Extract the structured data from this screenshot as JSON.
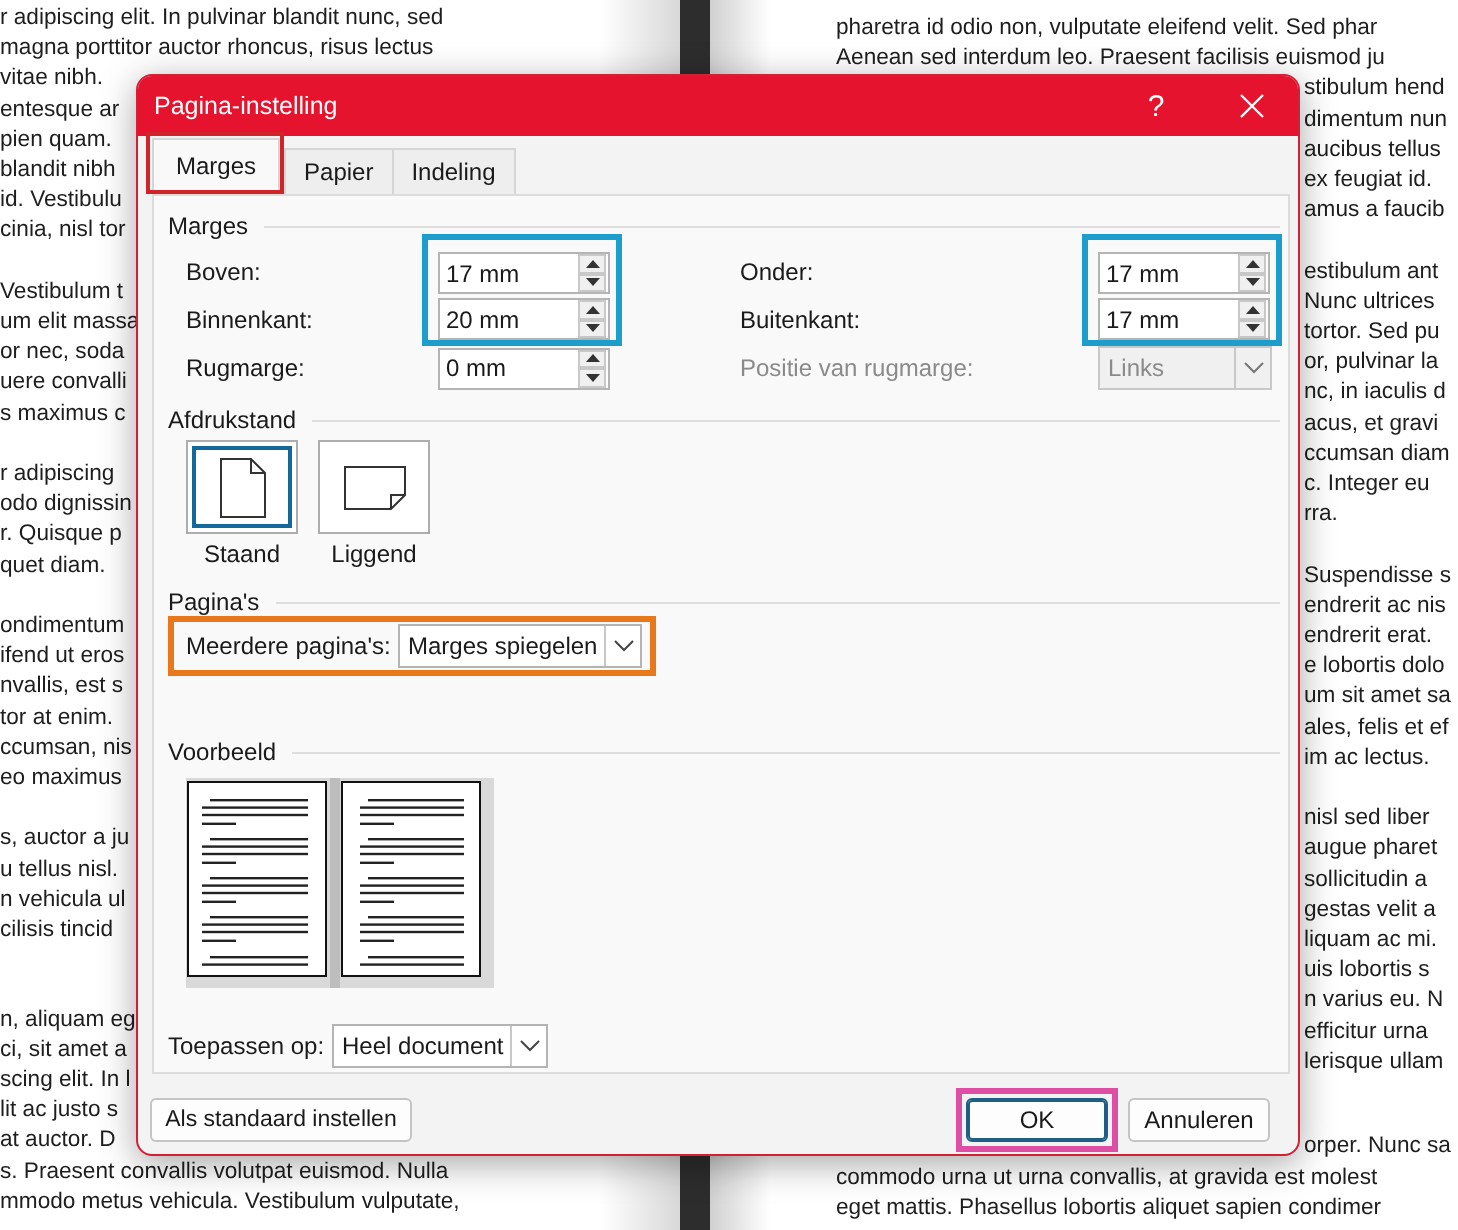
{
  "left_page": {
    "paragraphs": [
      [
        "r adipiscing elit. In pulvinar blandit nunc, sed",
        "magna porttitor auctor rhoncus, risus lectus",
        "vitae nibh.",
        "entesque ar",
        "pien quam.",
        "blandit nibh",
        "id. Vestibulu",
        "cinia, nisl tor"
      ],
      [
        "Vestibulum t",
        "um elit massa",
        "or nec, soda",
        "uere convalli",
        "s maximus c"
      ],
      [
        "r adipiscing",
        "odo dignissin",
        "r. Quisque p",
        "quet diam."
      ],
      [
        "ondimentum",
        "ifend ut eros",
        "nvallis, est s",
        "tor at enim.",
        "ccumsan, nis",
        "eo maximus"
      ],
      [
        "s, auctor a ju",
        "u tellus nisl.",
        "n vehicula ul",
        "cilisis tincid"
      ],
      [
        "n, aliquam eg",
        "ci, sit amet a",
        "scing elit. In l",
        "lit ac justo s",
        "at auctor. D",
        "s. Praesent convallis volutpat euismod. Nulla",
        "mmodo metus vehicula. Vestibulum vulputate,"
      ]
    ]
  },
  "right_page": {
    "paragraphs": [
      [
        {
          "text": "pharetra id odio non, vulputate eleifend velit. Sed phar",
          "kind": "full"
        },
        {
          "text": "Aenean sed interdum leo. Praesent facilisis euismod ju",
          "kind": "full"
        },
        {
          "text": "stibulum hend",
          "kind": "fragment"
        },
        {
          "text": "dimentum nun",
          "kind": "fragment"
        },
        {
          "text": "aucibus tellus",
          "kind": "fragment"
        },
        {
          "text": "ex feugiat id.",
          "kind": "fragment"
        },
        {
          "text": "amus a faucib",
          "kind": "fragment"
        }
      ],
      [
        {
          "text": "estibulum ant",
          "kind": "fragment"
        },
        {
          "text": "Nunc ultrices",
          "kind": "fragment"
        },
        {
          "text": "tortor. Sed pu",
          "kind": "fragment"
        },
        {
          "text": "or, pulvinar la",
          "kind": "fragment"
        },
        {
          "text": "nc, in iaculis d",
          "kind": "fragment"
        },
        {
          "text": "acus, et gravi",
          "kind": "fragment"
        },
        {
          "text": "ccumsan diam",
          "kind": "fragment"
        },
        {
          "text": "c. Integer eu",
          "kind": "fragment"
        },
        {
          "text": "rra.",
          "kind": "fragment"
        }
      ],
      [
        {
          "text": "Suspendisse s",
          "kind": "fragment"
        },
        {
          "text": "endrerit ac nis",
          "kind": "fragment"
        },
        {
          "text": "endrerit erat.",
          "kind": "fragment"
        },
        {
          "text": "e lobortis dolo",
          "kind": "fragment"
        },
        {
          "text": "um sit amet sa",
          "kind": "fragment"
        },
        {
          "text": "ales, felis et ef",
          "kind": "fragment"
        },
        {
          "text": "im ac lectus.",
          "kind": "fragment"
        }
      ],
      [
        {
          "text": "nisl sed liber",
          "kind": "fragment"
        },
        {
          "text": "augue pharet",
          "kind": "fragment"
        },
        {
          "text": "sollicitudin a",
          "kind": "fragment"
        },
        {
          "text": "gestas velit a",
          "kind": "fragment"
        },
        {
          "text": "liquam ac mi.",
          "kind": "fragment"
        },
        {
          "text": "uis lobortis s",
          "kind": "fragment"
        },
        {
          "text": "n varius eu. N",
          "kind": "fragment"
        },
        {
          "text": "efficitur urna",
          "kind": "fragment"
        },
        {
          "text": "lerisque ullam",
          "kind": "fragment"
        }
      ],
      [
        {
          "text": "orper. Nunc sa",
          "kind": "fragment"
        },
        {
          "text": "commodo urna ut urna convallis, at gravida est molest",
          "kind": "full"
        },
        {
          "text": "eget mattis. Phasellus lobortis aliquet sapien condimer",
          "kind": "full"
        }
      ]
    ]
  },
  "dialog": {
    "title": "Pagina-instelling",
    "help": "?",
    "tabs": [
      {
        "label": "Marges",
        "selected": true,
        "color": "#d1232a"
      },
      {
        "label": "Papier",
        "selected": false
      },
      {
        "label": "Indeling",
        "selected": false
      }
    ],
    "margins": {
      "heading": "Marges",
      "groups": [
        {
          "color": "#1d9dcc",
          "fields": [
            {
              "label": "Boven:",
              "value": "17 mm"
            },
            {
              "label": "Binnenkant:",
              "value": "20 mm"
            }
          ]
        },
        {
          "color": "#1d9dcc",
          "fields": [
            {
              "label": "Onder:",
              "value": "17 mm"
            },
            {
              "label": "Buitenkant:",
              "value": "17 mm"
            }
          ]
        }
      ],
      "gutter": {
        "label": "Rugmarge:",
        "value": "0 mm"
      },
      "gutter_position": {
        "label": "Positie van rugmarge:",
        "value": "Links",
        "disabled": true
      }
    },
    "orientation": {
      "heading": "Afdrukstand",
      "options": [
        {
          "label": "Staand",
          "kind": "portrait",
          "selected": true
        },
        {
          "label": "Liggend",
          "kind": "landscape",
          "selected": false
        }
      ]
    },
    "pages": {
      "heading": "Pagina's",
      "color": "#e8781a",
      "label": "Meerdere pagina's:",
      "value": "Marges spiegelen"
    },
    "preview": {
      "heading": "Voorbeeld"
    },
    "apply_to": {
      "label": "Toepassen op:",
      "value": "Heel document"
    },
    "buttons": [
      {
        "label": "Als standaard instellen",
        "kind": "secondary"
      },
      {
        "label": "OK",
        "kind": "default",
        "color": "#dc4fa5"
      },
      {
        "label": "Annuleren",
        "kind": "normal"
      }
    ]
  }
}
